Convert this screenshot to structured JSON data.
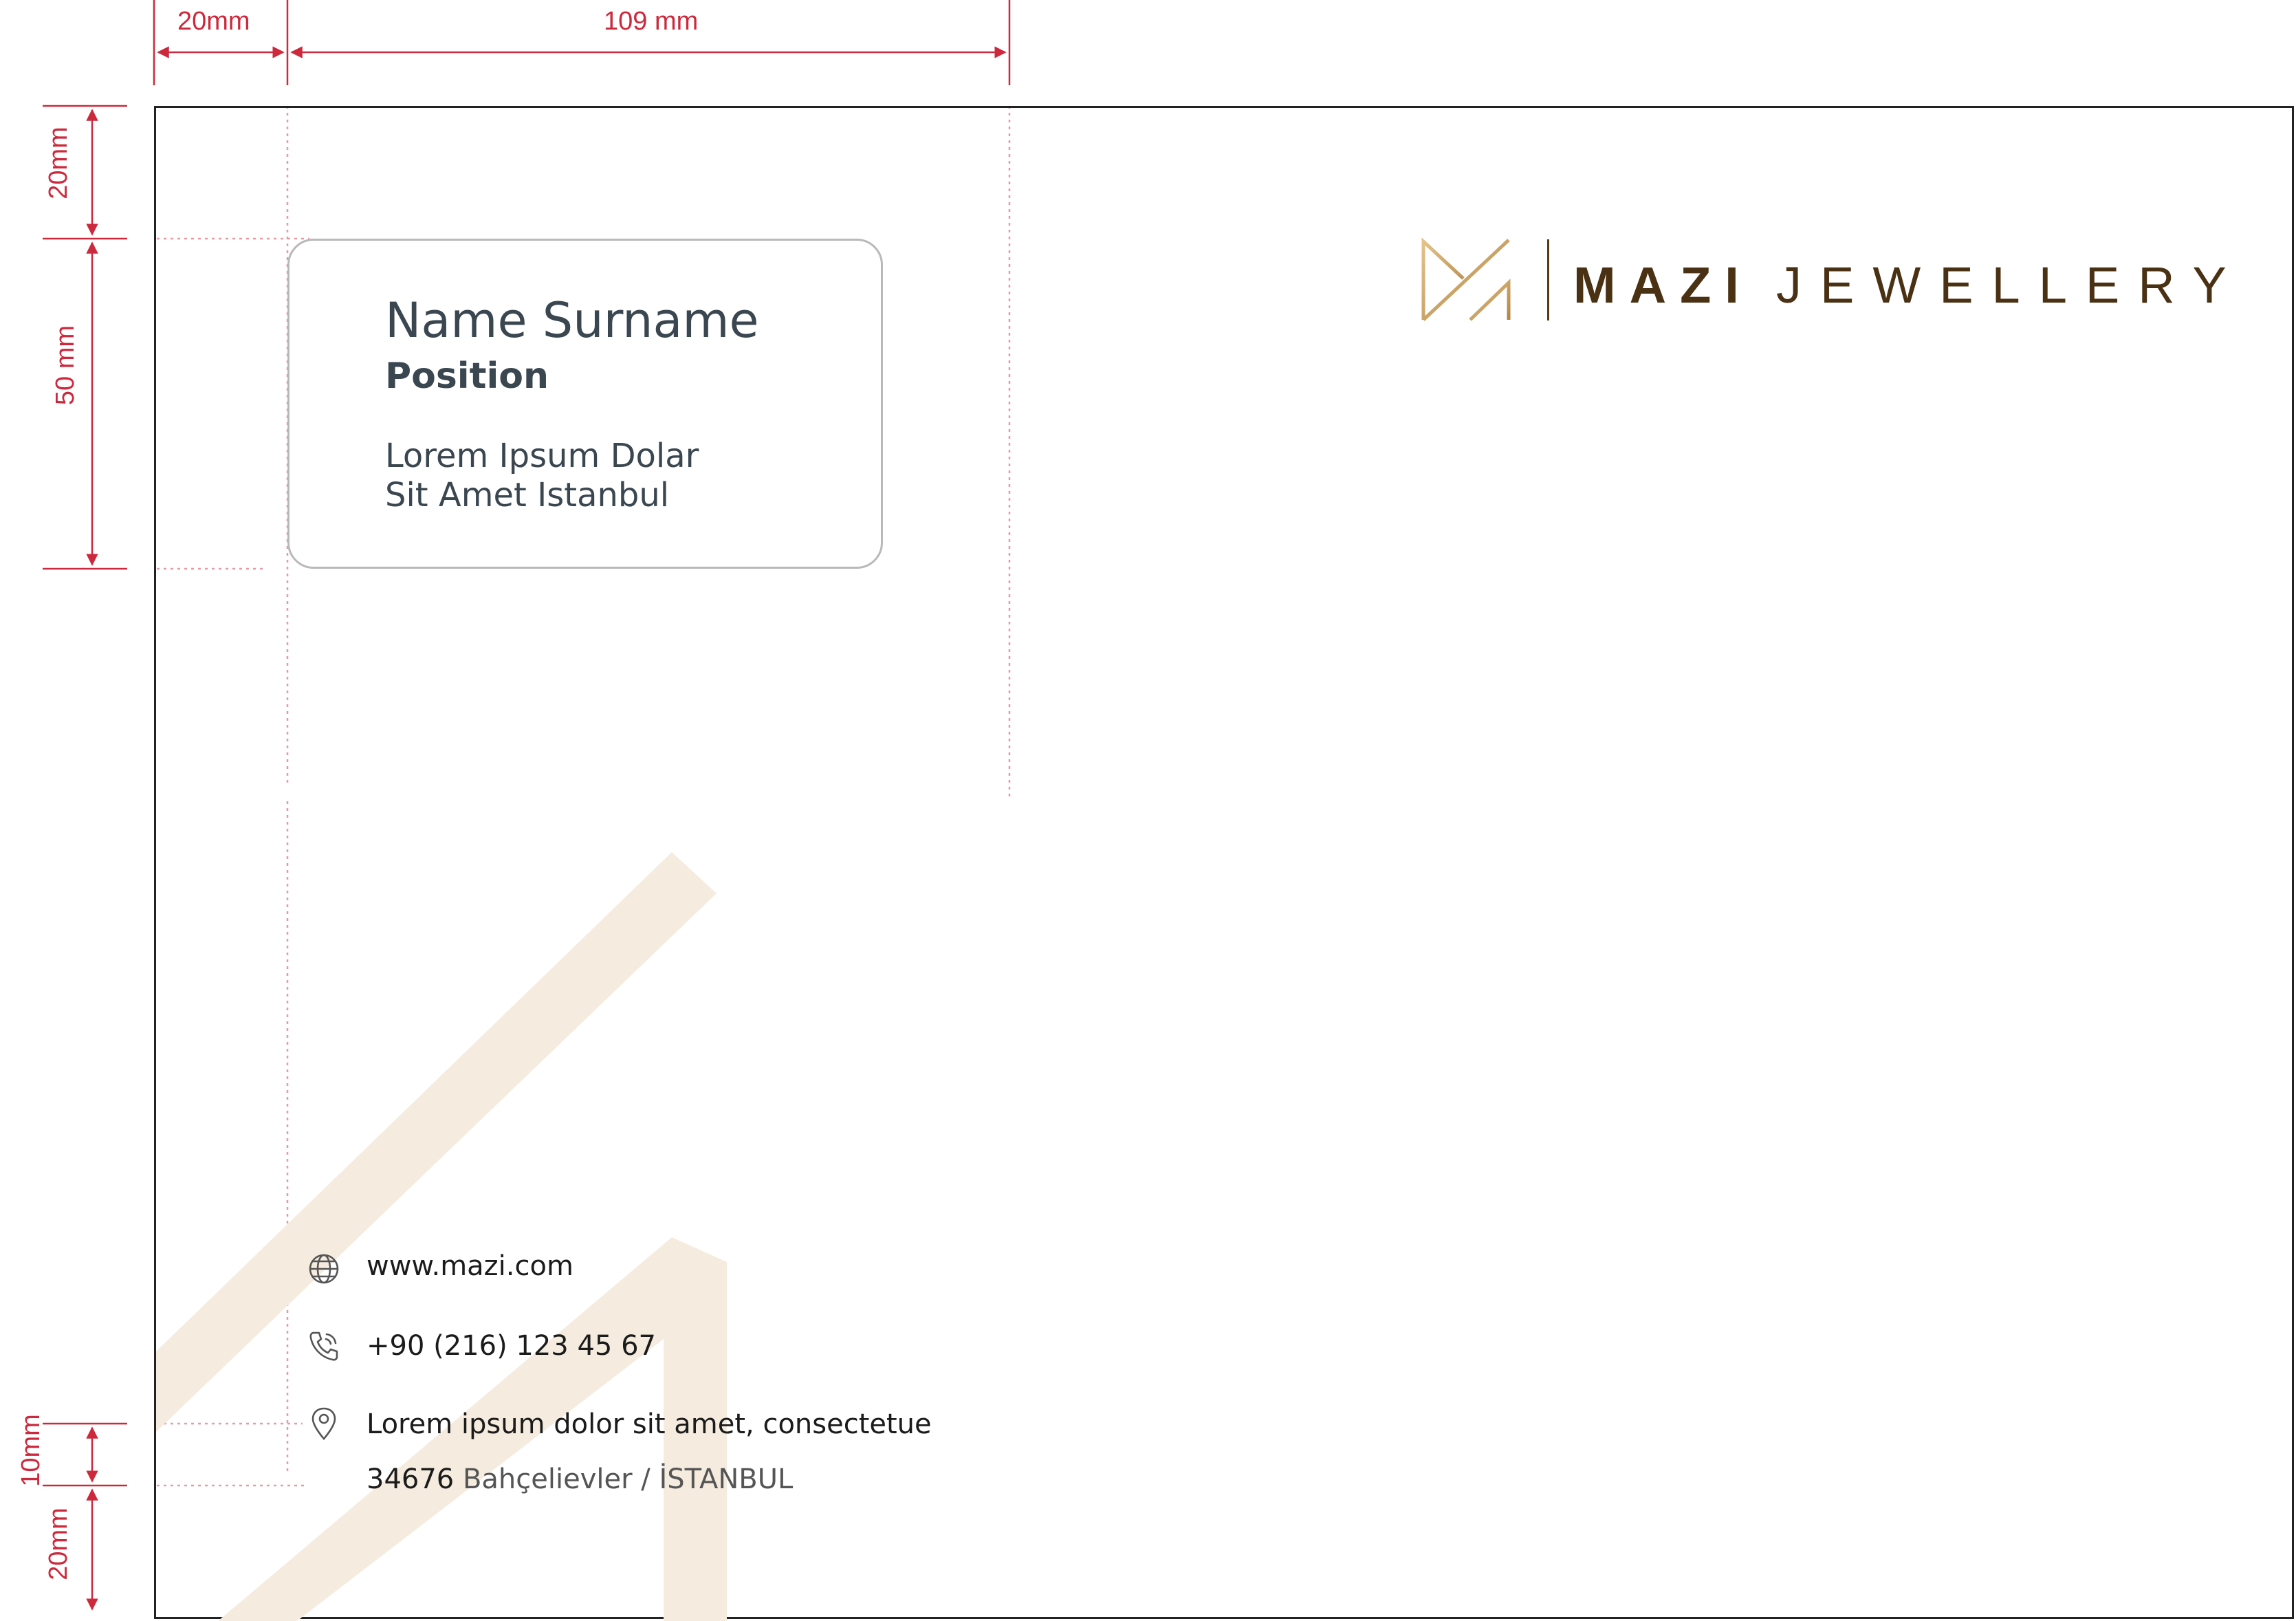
{
  "dimensions": {
    "left_margin": "20mm",
    "window_width": "109 mm",
    "top_margin": "20mm",
    "window_height": "50 mm",
    "contact_spacing": "10mm",
    "bottom_margin": "20mm"
  },
  "address_window": {
    "name": "Name Surname",
    "position": "Position",
    "address_line1": "Lorem Ipsum Dolar",
    "address_line2": "Sit Amet Istanbul"
  },
  "brand": {
    "bold": "MAZI",
    "light": "JEWELLERY",
    "colors": {
      "brand_text": "#4b3113",
      "gold": "#c9a062",
      "watermark": "#f5ecdf",
      "guide": "#cc2a3c"
    }
  },
  "contact": {
    "website": "www.mazi.com",
    "phone": "+90 (216) 123 45 67",
    "address_line1": "Lorem ipsum dolor sit amet, consectetue",
    "address_postcode": "34676",
    "address_district": "Bahçelievler / İSTANBUL",
    "icons": [
      "globe-icon",
      "phone-icon",
      "location-pin-icon"
    ]
  }
}
